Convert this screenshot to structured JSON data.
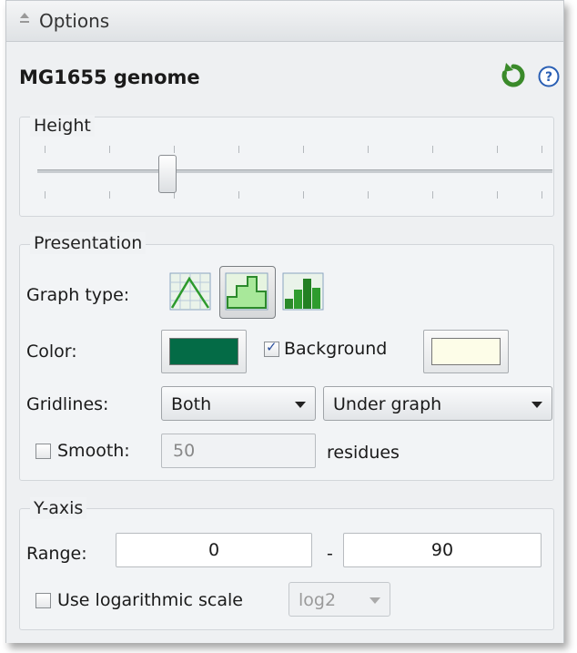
{
  "header": {
    "title": "Options"
  },
  "genome_title": "MG1655 genome",
  "height": {
    "label": "Height",
    "value_fraction": 0.25
  },
  "presentation": {
    "label": "Presentation",
    "graph_type": {
      "label": "Graph type:",
      "options": [
        "line-graph-icon",
        "step-graph-icon",
        "bar-graph-icon"
      ],
      "selected": "step-graph-icon"
    },
    "color": {
      "label": "Color:",
      "value": "#046b46",
      "background_checked": true,
      "background_label": "Background",
      "background_value": "#fdfde8"
    },
    "gridlines": {
      "label": "Gridlines:",
      "axis_value": "Both",
      "position_value": "Under graph"
    },
    "smooth": {
      "checked": false,
      "label": "Smooth:",
      "value": "50",
      "unit": "residues"
    }
  },
  "yaxis": {
    "label": "Y-axis",
    "range_label": "Range:",
    "min": "0",
    "separator": "-",
    "max": "90",
    "log_checked": false,
    "log_label": "Use logarithmic scale",
    "log_base": "log2"
  }
}
